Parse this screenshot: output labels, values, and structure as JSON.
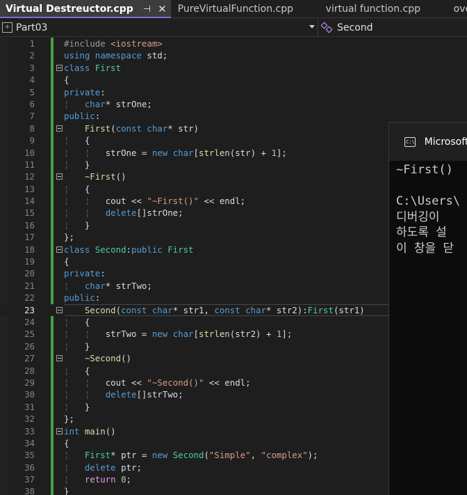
{
  "tabs": [
    {
      "label": "Virtual Destreuctor.cpp",
      "active": true,
      "pin_icon": "pin-icon",
      "close_icon": "close-icon"
    },
    {
      "label": "PureVirtualFunction.cpp",
      "active": false
    },
    {
      "label": "virtual function.cpp",
      "active": false
    },
    {
      "label": "overridi",
      "active": false
    }
  ],
  "nav": {
    "project_label": "Part03",
    "project_icon": "project-icon",
    "class_label": "Second",
    "class_icon": "class-icon"
  },
  "editor": {
    "current_line": 23,
    "lines": [
      {
        "n": "1",
        "t": [
          [
            "pp",
            "#include "
          ],
          [
            "st",
            "<iostream>"
          ]
        ]
      },
      {
        "n": "2",
        "t": [
          [
            "kw",
            "using namespace "
          ],
          [
            "",
            "std;"
          ]
        ]
      },
      {
        "n": "3",
        "f": true,
        "t": [
          [
            "kw",
            "class "
          ],
          [
            "ty",
            "First"
          ]
        ]
      },
      {
        "n": "4",
        "t": [
          [
            "",
            "{"
          ]
        ]
      },
      {
        "n": "5",
        "t": [
          [
            "kw",
            "private"
          ],
          [
            "",
            ":"
          ]
        ]
      },
      {
        "n": "6",
        "t": [
          [
            "gd",
            "¦   "
          ],
          [
            "kw",
            "char"
          ],
          [
            "",
            "* strOne;"
          ]
        ]
      },
      {
        "n": "7",
        "t": [
          [
            "kw",
            "public"
          ],
          [
            "",
            ":"
          ]
        ]
      },
      {
        "n": "8",
        "f": true,
        "t": [
          [
            "",
            "    "
          ],
          [
            "fn",
            "First"
          ],
          [
            "",
            "("
          ],
          [
            "kw",
            "const char"
          ],
          [
            "",
            "* str)"
          ]
        ]
      },
      {
        "n": "9",
        "t": [
          [
            "gd",
            "¦   "
          ],
          [
            "",
            "{"
          ]
        ]
      },
      {
        "n": "10",
        "t": [
          [
            "gd",
            "¦   ¦   "
          ],
          [
            "",
            "strOne = "
          ],
          [
            "kw",
            "new char"
          ],
          [
            "",
            "["
          ],
          [
            "fn",
            "strlen"
          ],
          [
            "",
            "(str) + "
          ],
          [
            "nu",
            "1"
          ],
          [
            "",
            "];"
          ]
        ]
      },
      {
        "n": "11",
        "t": [
          [
            "gd",
            "¦   "
          ],
          [
            "",
            "}"
          ]
        ]
      },
      {
        "n": "12",
        "f": true,
        "t": [
          [
            "",
            "    "
          ],
          [
            "fn",
            "~First"
          ],
          [
            "",
            "()"
          ]
        ]
      },
      {
        "n": "13",
        "t": [
          [
            "gd",
            "¦   "
          ],
          [
            "",
            "{"
          ]
        ]
      },
      {
        "n": "14",
        "t": [
          [
            "gd",
            "¦   ¦   "
          ],
          [
            "",
            "cout << "
          ],
          [
            "st",
            "\"~First()\""
          ],
          [
            "",
            " << endl;"
          ]
        ]
      },
      {
        "n": "15",
        "t": [
          [
            "gd",
            "¦   ¦   "
          ],
          [
            "kw",
            "delete"
          ],
          [
            "",
            "[]strOne;"
          ]
        ]
      },
      {
        "n": "16",
        "t": [
          [
            "gd",
            "¦   "
          ],
          [
            "",
            "}"
          ]
        ]
      },
      {
        "n": "17",
        "t": [
          [
            "",
            "};"
          ]
        ]
      },
      {
        "n": "18",
        "f": true,
        "t": [
          [
            "kw",
            "class "
          ],
          [
            "ty",
            "Second"
          ],
          [
            "",
            ":"
          ],
          [
            "kw",
            "public "
          ],
          [
            "ty",
            "First"
          ]
        ]
      },
      {
        "n": "19",
        "t": [
          [
            "",
            "{"
          ]
        ]
      },
      {
        "n": "20",
        "t": [
          [
            "kw",
            "private"
          ],
          [
            "",
            ":"
          ]
        ]
      },
      {
        "n": "21",
        "t": [
          [
            "gd",
            "¦   "
          ],
          [
            "kw",
            "char"
          ],
          [
            "",
            "* strTwo;"
          ]
        ]
      },
      {
        "n": "22",
        "t": [
          [
            "kw",
            "public"
          ],
          [
            "",
            ":"
          ]
        ]
      },
      {
        "n": "23",
        "f": true,
        "t": [
          [
            "",
            "    "
          ],
          [
            "fn",
            "Second"
          ],
          [
            "",
            "("
          ],
          [
            "kw",
            "const char"
          ],
          [
            "",
            "* str1, "
          ],
          [
            "kw",
            "const char"
          ],
          [
            "",
            "* str2):"
          ],
          [
            "ty",
            "First"
          ],
          [
            "",
            "(str1)"
          ]
        ]
      },
      {
        "n": "24",
        "t": [
          [
            "gd",
            "¦   "
          ],
          [
            "",
            "{"
          ]
        ]
      },
      {
        "n": "25",
        "t": [
          [
            "gd",
            "¦   ¦   "
          ],
          [
            "",
            "strTwo = "
          ],
          [
            "kw",
            "new char"
          ],
          [
            "",
            "["
          ],
          [
            "fn",
            "strlen"
          ],
          [
            "",
            "(str2) + "
          ],
          [
            "nu",
            "1"
          ],
          [
            "",
            "];"
          ]
        ]
      },
      {
        "n": "26",
        "t": [
          [
            "gd",
            "¦   "
          ],
          [
            "",
            "}"
          ]
        ]
      },
      {
        "n": "27",
        "f": true,
        "t": [
          [
            "",
            "    "
          ],
          [
            "fn",
            "~Second"
          ],
          [
            "",
            "()"
          ]
        ]
      },
      {
        "n": "28",
        "t": [
          [
            "gd",
            "¦   "
          ],
          [
            "",
            "{"
          ]
        ]
      },
      {
        "n": "29",
        "t": [
          [
            "gd",
            "¦   ¦   "
          ],
          [
            "",
            "cout << "
          ],
          [
            "st",
            "\"~Second()\""
          ],
          [
            "",
            " << endl;"
          ]
        ]
      },
      {
        "n": "30",
        "t": [
          [
            "gd",
            "¦   ¦   "
          ],
          [
            "kw",
            "delete"
          ],
          [
            "",
            "[]strTwo;"
          ]
        ]
      },
      {
        "n": "31",
        "t": [
          [
            "gd",
            "¦   "
          ],
          [
            "",
            "}"
          ]
        ]
      },
      {
        "n": "32",
        "t": [
          [
            "",
            "};"
          ]
        ]
      },
      {
        "n": "33",
        "f": true,
        "t": [
          [
            "kw",
            "int "
          ],
          [
            "fn",
            "main"
          ],
          [
            "",
            "()"
          ]
        ]
      },
      {
        "n": "34",
        "t": [
          [
            "",
            "{"
          ]
        ]
      },
      {
        "n": "35",
        "t": [
          [
            "gd",
            "¦   "
          ],
          [
            "ty",
            "First"
          ],
          [
            "",
            "* ptr = "
          ],
          [
            "kw",
            "new "
          ],
          [
            "ty",
            "Second"
          ],
          [
            "",
            "("
          ],
          [
            "st",
            "\"Simple\""
          ],
          [
            "",
            ", "
          ],
          [
            "st",
            "\"complex\""
          ],
          [
            "",
            ");"
          ]
        ]
      },
      {
        "n": "36",
        "t": [
          [
            "gd",
            "¦   "
          ],
          [
            "kw",
            "delete "
          ],
          [
            "",
            "ptr;"
          ]
        ]
      },
      {
        "n": "37",
        "t": [
          [
            "gd",
            "¦   "
          ],
          [
            "cf",
            "return "
          ],
          [
            "nu",
            "0"
          ],
          [
            "",
            ";"
          ]
        ]
      },
      {
        "n": "38",
        "t": [
          [
            "",
            "}"
          ]
        ]
      }
    ]
  },
  "console": {
    "title": "Microsoft",
    "icon": "terminal-icon",
    "lines": [
      "~First()",
      "",
      "C:\\Users\\",
      "디버깅이",
      "하도록 설",
      "이 창을 닫"
    ]
  }
}
